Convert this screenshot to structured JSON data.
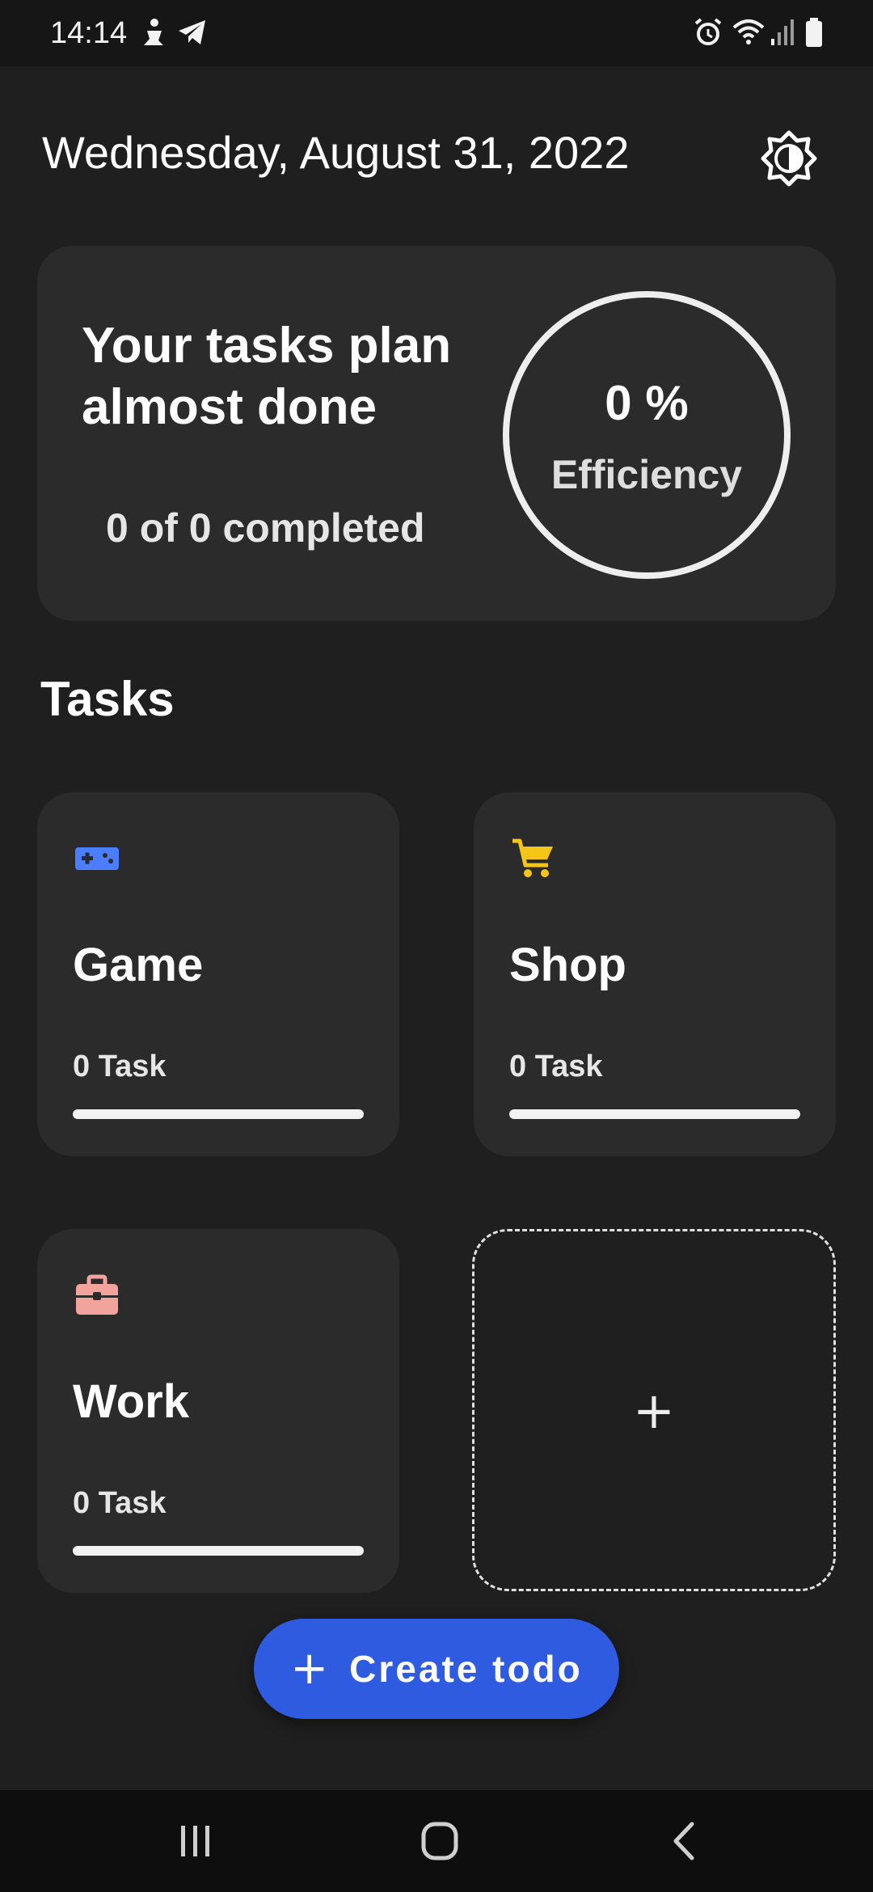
{
  "status_bar": {
    "time": "14:14",
    "left_icons": [
      "person-status-icon",
      "telegram-icon"
    ],
    "right_icons": [
      "alarm-icon",
      "wifi-icon",
      "signal-icon",
      "battery-icon"
    ]
  },
  "header": {
    "date": "Wednesday, August 31, 2022",
    "theme_icon": "brightness-icon"
  },
  "summary": {
    "headline": "Your tasks plan almost done",
    "completed_text": "0 of 0 completed",
    "efficiency_value": "0 %",
    "efficiency_label": "Efficiency",
    "efficiency_fraction": 0
  },
  "tasks_section": {
    "title": "Tasks",
    "categories": [
      {
        "name": "Game",
        "count": "0 Task",
        "icon": "gamepad-icon",
        "icon_color": "#4a7dff",
        "progress": 0
      },
      {
        "name": "Shop",
        "count": "0 Task",
        "icon": "cart-icon",
        "icon_color": "#f5c518",
        "progress": 0
      },
      {
        "name": "Work",
        "count": "0 Task",
        "icon": "briefcase-icon",
        "icon_color": "#f2a49c",
        "progress": 0
      }
    ],
    "add_label": "+"
  },
  "fab": {
    "plus": "+",
    "label": "Create todo",
    "color": "#2f5be0"
  },
  "nav_bar": {
    "items": [
      "recents-icon",
      "home-icon",
      "back-icon"
    ]
  }
}
